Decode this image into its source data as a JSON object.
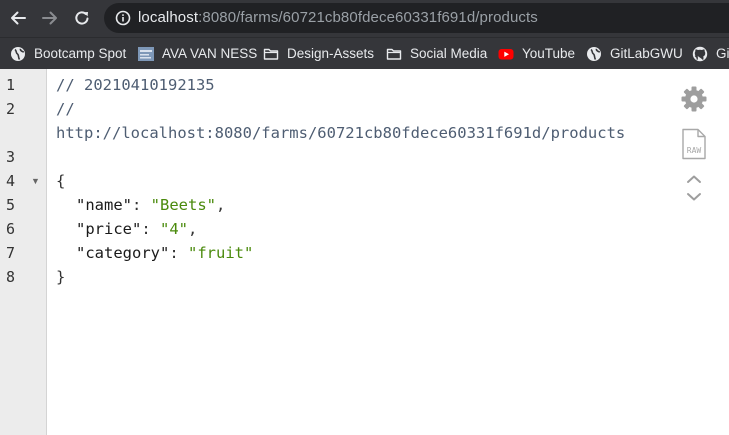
{
  "browser": {
    "url_host": "localhost",
    "url_path": ":8080/farms/60721cb80fdece60331f691d/products"
  },
  "bookmarks": [
    {
      "label": "Bootcamp Spot",
      "icon": "globe-icon"
    },
    {
      "label": "AVA VAN NESS",
      "icon": "site-thumbnail-icon"
    },
    {
      "label": "Design-Assets",
      "icon": "folder-icon"
    },
    {
      "label": "Social Media",
      "icon": "folder-icon"
    },
    {
      "label": "YouTube",
      "icon": "youtube-icon"
    },
    {
      "label": "GitLabGWU",
      "icon": "globe-icon"
    },
    {
      "label": "Gi",
      "icon": "github-icon"
    }
  ],
  "viewer": {
    "line_numbers": [
      "1",
      "2",
      "3",
      "4",
      "5",
      "6",
      "7",
      "8"
    ],
    "comment_timestamp": "// 20210410192135",
    "comment_slashes": "//",
    "comment_url": "http://localhost:8080/farms/60721cb80fdece60331f691d/products",
    "open_brace": "{",
    "close_brace": "}",
    "fields": [
      {
        "key": "\"name\"",
        "value": "\"Beets\"",
        "trailing": ","
      },
      {
        "key": "\"price\"",
        "value": "\"4\"",
        "trailing": ","
      },
      {
        "key": "\"category\"",
        "value": "\"fruit\"",
        "trailing": ""
      }
    ],
    "colon": ": ",
    "raw_label": "RAW"
  },
  "colors": {
    "chrome_bg": "#35363a",
    "omnibox_bg": "#202124",
    "gutter_bg": "#ececec",
    "string_green": "#4a8a0c",
    "comment_slate": "#4e5d72"
  }
}
